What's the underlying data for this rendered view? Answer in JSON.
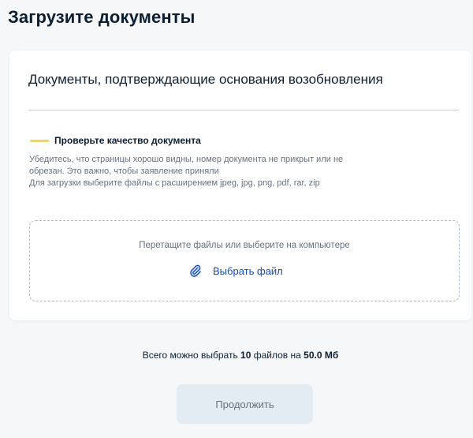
{
  "page": {
    "title": "Загрузите документы"
  },
  "card": {
    "title": "Документы, подтверждающие основания возобновления",
    "notice": {
      "title": "Проверьте качество документа",
      "line1": "Убедитесь, что страницы хорошо видны, номер документа не прикрыт или не",
      "line2": "обрезан. Это важно, чтобы заявление приняли",
      "line3": "Для загрузки выберите файлы с расширением jpeg, jpg, png, pdf, rar, zip"
    },
    "dropzone": {
      "hint": "Перетащите файлы или выберите на компьютере",
      "choose_label": "Выбрать файл",
      "icon": "paperclip-icon"
    }
  },
  "limit": {
    "prefix": "Всего можно выбрать ",
    "count": "10",
    "middle": " файлов на ",
    "size": "50.0 Мб"
  },
  "actions": {
    "continue_label": "Продолжить"
  },
  "colors": {
    "accent": "#0d4cd3",
    "notice_bar": "#fdd835",
    "button_disabled_bg": "#e4ecf3",
    "muted_text": "#66727f"
  }
}
